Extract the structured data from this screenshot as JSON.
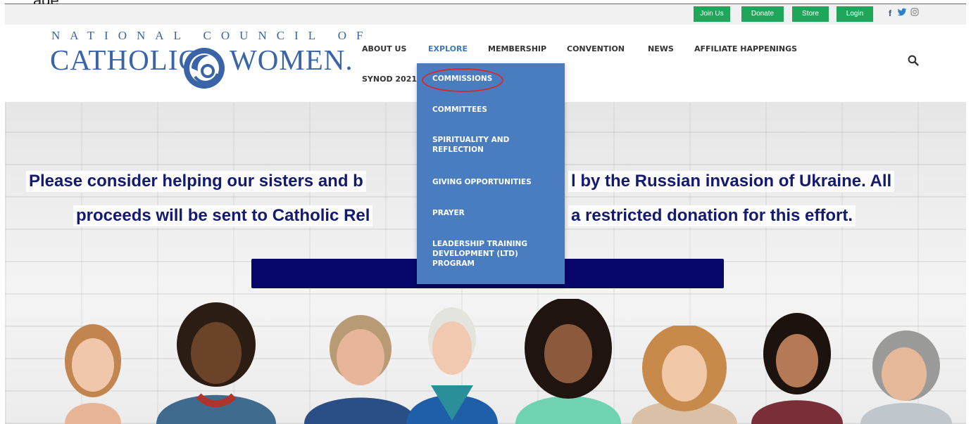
{
  "topbar": {
    "cut_text": "age",
    "buttons": [
      "Join Us",
      "Donate",
      "Store",
      "Login"
    ],
    "social": [
      "f",
      "twitter-icon",
      "instagram-icon"
    ]
  },
  "logo": {
    "top_line": "NATIONAL COUNCIL OF",
    "left_word": "CATHOLIC",
    "right_word": "WOMEN.",
    "brand_color": "#3a64a8"
  },
  "nav": {
    "items": [
      "ABOUT US",
      "EXPLORE",
      "MEMBERSHIP",
      "CONVENTION",
      "NEWS",
      "AFFILIATE HAPPENINGS",
      "SYNOD 2021"
    ],
    "active": "EXPLORE",
    "active_color": "#3a7bbf"
  },
  "dropdown": {
    "items": [
      "COMMISSIONS",
      "COMMITTEES",
      "SPIRITUALITY AND REFLECTION",
      "GIVING OPPORTUNITIES",
      "PRAYER",
      "LEADERSHIP TRAINING DEVELOPMENT (LTD) PROGRAM"
    ],
    "highlighted": "COMMISSIONS",
    "bg_color": "#4a7dc0",
    "ring_color": "#d42a2a"
  },
  "hero": {
    "line1_left": "Please consider helping our sisters and b",
    "line1_right": "l by the Russian invasion of Ukraine.  All",
    "line2_left": "proceeds will be sent to Catholic Rel",
    "line2_right": "a restricted donation for this effort.",
    "text_color": "#141a6e",
    "button_color": "#07066a"
  }
}
